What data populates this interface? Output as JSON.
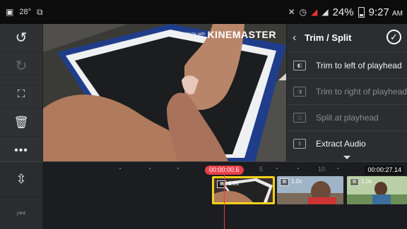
{
  "status_bar": {
    "temperature": "28°",
    "battery_percent": "24%",
    "time": "9:27",
    "time_suffix": "AM"
  },
  "left_toolbar": {
    "icons": [
      "undo-icon",
      "redo-icon",
      "fit-screen-icon",
      "delete-icon",
      "more-icon"
    ]
  },
  "preview": {
    "watermark_small": "Made with",
    "watermark_big": "KINEMASTER"
  },
  "trim_panel": {
    "title": "Trim / Split",
    "items": [
      {
        "label": "Trim to left of playhead",
        "enabled": true
      },
      {
        "label": "Trim to right of playhead",
        "enabled": false
      },
      {
        "label": "Split at playhead",
        "enabled": false
      },
      {
        "label": "Extract Audio",
        "enabled": true
      }
    ]
  },
  "timeline": {
    "playhead_time": "00:00:00.6",
    "end_time": "00:00:27.14",
    "ruler_marks": [
      "5",
      "10"
    ],
    "clips": [
      {
        "speed": "1.0x",
        "selected": true
      },
      {
        "speed": "1.0x",
        "selected": false
      },
      {
        "speed": "1.0x",
        "selected": false
      }
    ]
  },
  "colors": {
    "accent_selection": "#f2d11a",
    "playhead": "#e8404a",
    "panel_bg": "#2b2d30"
  }
}
